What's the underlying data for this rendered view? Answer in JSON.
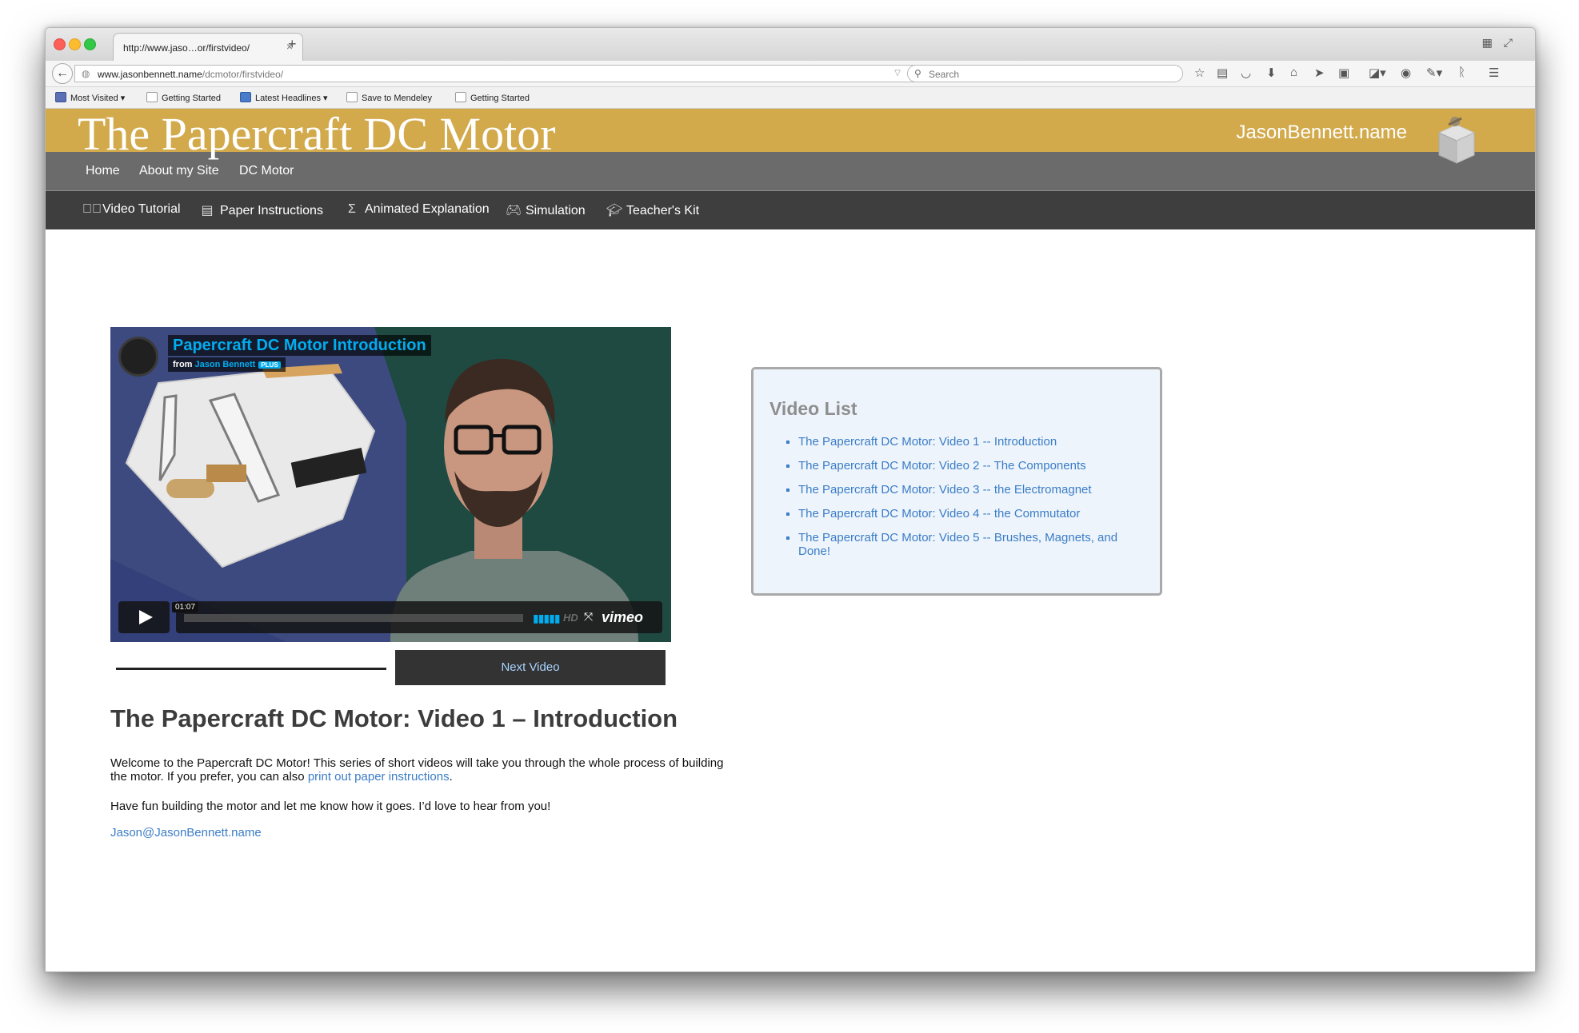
{
  "browser": {
    "tab_title": "http://www.jaso…or/firstvideo/",
    "tab_close": "×",
    "new_tab": "+",
    "url_host": "www.jasonbennett.name",
    "url_path": "/dcmotor/firstvideo/",
    "search_placeholder": "Search",
    "bookmarks": [
      "Most Visited ▾",
      "Getting Started",
      "Latest Headlines ▾",
      "Save to Mendeley",
      "Getting Started"
    ],
    "toolbar_icons": [
      "star-icon",
      "reading-list-icon",
      "pocket-icon",
      "download-icon",
      "home-icon",
      "send-icon",
      "screenshot-icon",
      "translate-icon",
      "chat-icon",
      "extension-icon",
      "readability-icon",
      "menu-icon"
    ]
  },
  "site": {
    "title": "The Papercraft DC Motor",
    "site_name": "JasonBennett.name",
    "banner_color": "#d2aa4b",
    "menu": [
      "Home",
      "About my Site",
      "DC Motor"
    ],
    "subnav": [
      {
        "label": "Video Tutorial",
        "icon": "play-square-icon"
      },
      {
        "label": "Paper Instructions",
        "icon": "document-icon"
      },
      {
        "label": "Animated Explanation",
        "icon": "sigma-icon"
      },
      {
        "label": "Simulation",
        "icon": "gamepad-icon"
      },
      {
        "label": "Teacher's Kit",
        "icon": "graduation-cap-icon"
      }
    ]
  },
  "video": {
    "title": "Papercraft DC Motor Introduction",
    "from_label": "from",
    "author": "Jason Bennett",
    "badge": "PLUS",
    "timecode": "01:07",
    "hd_label": "HD",
    "brand": "vimeo",
    "accent": "#00adef"
  },
  "next_video_label": "Next Video",
  "content": {
    "heading": "The Papercraft DC Motor: Video 1 – Introduction",
    "intro_before_link": "Welcome to the Papercraft DC Motor! This series of short videos will take you through the whole process of building the motor. If you prefer, you can also ",
    "intro_link": "print out paper instructions",
    "intro_after_link": ".",
    "followup": "Have fun building the motor and let me know how it goes. I’d love to hear from you!",
    "email": "Jason@JasonBennett.name"
  },
  "video_list": {
    "title": "Video List",
    "items": [
      "The Papercraft DC Motor: Video 1 -- Introduction",
      "The Papercraft DC Motor: Video 2 -- The Components",
      "The Papercraft DC Motor: Video 3 -- the Electromagnet",
      "The Papercraft DC Motor: Video 4 -- the Commutator",
      "The Papercraft DC Motor: Video 5 -- Brushes, Magnets, and Done!"
    ]
  }
}
